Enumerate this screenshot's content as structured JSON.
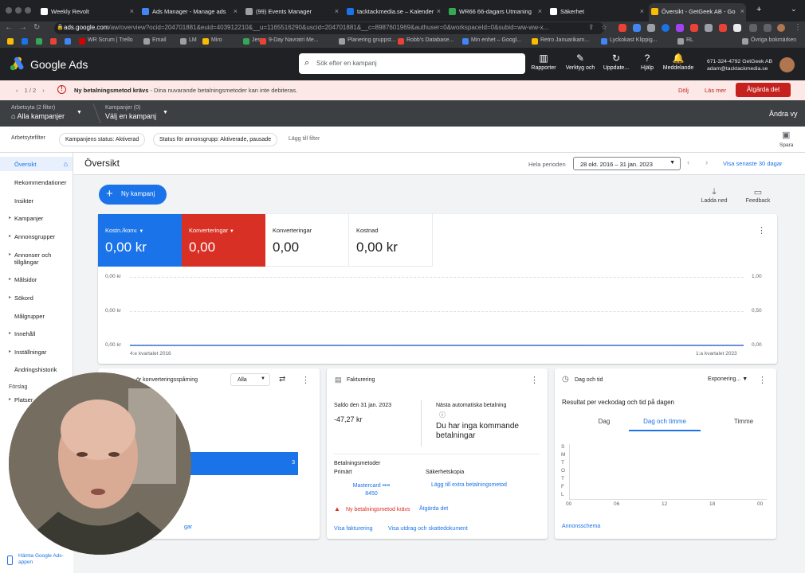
{
  "browser": {
    "tabs": [
      {
        "title": "Weekly Revolt",
        "color": "#ffffff",
        "active": false
      },
      {
        "title": "Ads Manager - Manage ads",
        "color": "#4285f4",
        "active": false
      },
      {
        "title": "(99) Events Manager",
        "color": "#9aa0a6",
        "active": false
      },
      {
        "title": "tacktackmedia.se – Kalender",
        "color": "#1a73e8",
        "active": false
      },
      {
        "title": "WR66 66-dagars Utmaning",
        "color": "#34a853",
        "active": false
      },
      {
        "title": "Säkerhet",
        "color": "#ffffff",
        "active": false
      },
      {
        "title": "Översikt - GetGeek AB - Go",
        "color": "#fbbc04",
        "active": true
      }
    ],
    "url_host": "ads.google.com",
    "url_rest": "/aw/overview?ocid=204701881&euid=403912210&__u=1165516290&uscid=204701881&__c=8987601969&authuser=0&workspaceId=0&subid=ww-ww-x...",
    "bookmarks": [
      {
        "label": "",
        "color": "#fbbc04"
      },
      {
        "label": "",
        "color": "#1a73e8"
      },
      {
        "label": "",
        "color": "#34a853"
      },
      {
        "label": "",
        "color": "#ea4335"
      },
      {
        "label": "",
        "color": "#4285f4"
      },
      {
        "label": "WR Scrum | Trello",
        "color": "#d50000"
      },
      {
        "label": "Email",
        "color": "#9aa0a6"
      },
      {
        "label": "LM",
        "color": "#9aa0a6"
      },
      {
        "label": "Miro",
        "color": "#fbbc04"
      },
      {
        "label": "Jes",
        "color": "#34a853"
      },
      {
        "label": "9-Day Navratri Me...",
        "color": "#ea4335"
      },
      {
        "label": "Planering gruppst...",
        "color": "#9aa0a6"
      },
      {
        "label": "Robb's Database...",
        "color": "#ea4335"
      },
      {
        "label": "Min enhet – Googl...",
        "color": "#4285f4"
      },
      {
        "label": "Retro Januarikam...",
        "color": "#fbbc04"
      },
      {
        "label": "Lyckokast Klippig...",
        "color": "#4285f4"
      },
      {
        "label": "RL",
        "color": "#9aa0a6"
      },
      {
        "label": "Övriga bokmärken",
        "color": "#9aa0a6"
      }
    ]
  },
  "header": {
    "brand": "Google Ads",
    "search_placeholder": "Sök efter en kampanj",
    "buttons": [
      {
        "label": "Rapporter",
        "icon": "bar-chart-icon",
        "glyph": "▥"
      },
      {
        "label": "Verktyg och",
        "icon": "wrench-icon",
        "glyph": "✎"
      },
      {
        "label": "Uppdate...",
        "icon": "refresh-icon",
        "glyph": "↻"
      },
      {
        "label": "Hjälp",
        "icon": "help-icon",
        "glyph": "?"
      },
      {
        "label": "Meddelande",
        "icon": "bell-icon",
        "glyph": "🔔"
      }
    ],
    "account_line1": "671-324-4792 GetGeek AB",
    "account_line2": "adam@tacktackmedia.se"
  },
  "banner": {
    "pagination": "1 / 2",
    "title": "Ny betalningsmetod krävs",
    "text": " - Dina nuvarande betalningsmetoder kan inte debiteras.",
    "dismiss": "Dölj",
    "learn_more": "Läs mer",
    "fix": "Åtgärda det"
  },
  "workspace": {
    "scope_label": "Arbetsyta (2 filter)",
    "scope_value": "Alla kampanjer",
    "campaign_label": "Kampanjer (0)",
    "campaign_value": "Välj en kampanj",
    "change_view": "Ändra vy"
  },
  "filters": {
    "label": "Arbetsytefilter",
    "chips": [
      "Kampanjens status: Aktiverad",
      "Status för annonsgrupp: Aktiverade, pausade"
    ],
    "add": "Lägg till filter",
    "save": "Spara"
  },
  "sidebar": {
    "items": [
      {
        "label": "Översikt",
        "arrow": false
      },
      {
        "label": "Rekommendationer",
        "arrow": false
      },
      {
        "label": "Insikter",
        "arrow": false
      },
      {
        "label": "Kampanjer",
        "arrow": true
      },
      {
        "label": "Annonsgrupper",
        "arrow": true
      },
      {
        "label": "Annonser och tillgångar",
        "arrow": true
      },
      {
        "label": "Målsidor",
        "arrow": true
      },
      {
        "label": "Sökord",
        "arrow": true
      },
      {
        "label": "Målgrupper",
        "arrow": false
      },
      {
        "label": "Innehåll",
        "arrow": true
      },
      {
        "label": "Inställningar",
        "arrow": true
      },
      {
        "label": "Ändringshistorik",
        "arrow": false
      }
    ],
    "section": "Förslag",
    "section_items": [
      "Platser"
    ],
    "get_app": "Hämta Google Ads-appen"
  },
  "overview": {
    "title": "Översikt",
    "period_label": "Hela perioden",
    "date_range": "28 okt. 2016 – 31 jan. 2023",
    "last30": "Visa senaste 30 dagar",
    "new_campaign": "Ny kampanj",
    "download": "Ladda ned",
    "feedback": "Feedback"
  },
  "kpis": [
    {
      "label": "Kostn./konv.",
      "value": "0,00 kr",
      "dropdown": true
    },
    {
      "label": "Konverteringar",
      "value": "0,00",
      "dropdown": true
    },
    {
      "label": "Konverteringar",
      "value": "0,00",
      "dropdown": false
    },
    {
      "label": "Kostnad",
      "value": "0,00 kr",
      "dropdown": false
    }
  ],
  "chart_data": {
    "type": "line",
    "x": [
      "4:e kvartalet 2016",
      "1:a kvartalet 2023"
    ],
    "series": [
      {
        "values": [
          0,
          0
        ],
        "color": "#d93025"
      },
      {
        "values": [
          0,
          0
        ],
        "color": "#1a73e8"
      }
    ],
    "left_axis_ticks": [
      "0,00 kr",
      "0,00 kr",
      "0,00 kr"
    ],
    "right_axis_ticks": [
      "1,00",
      "0,50",
      "0,00"
    ],
    "ylim": [
      0,
      1
    ]
  },
  "conversion_card": {
    "title_fragment": "ör konverteringsspårning",
    "select": "Alla",
    "bar_value": "3",
    "bar_fraction": 1,
    "footer_fragment": "gar"
  },
  "billing_card": {
    "title": "Fakturering",
    "balance_label": "Saldo den 31 jan. 2023",
    "balance": "-47,27 kr",
    "next_label": "Nästa automatiska betalning",
    "next_value": "Du har inga kommande betalningar",
    "methods_label": "Betalningsmetoder",
    "primary_label": "Primärt",
    "primary_card": "Mastercard •••• 8450",
    "backup_label": "Säkerhetskopia",
    "add_backup": "Lägg till extra betalningsmetod",
    "error": "Ny betalningsmetod krävs",
    "fix": "Åtgärda det",
    "view_billing": "Visa fakturering",
    "view_docs": "Visa utdrag och skattedokument"
  },
  "daytime_card": {
    "title": "Dag och tid",
    "metric": "Exponering...",
    "subtitle": "Resultat per veckodag och tid på dagen",
    "tabs": [
      "Dag",
      "Dag och timme",
      "Timme"
    ],
    "days": [
      "S",
      "M",
      "T",
      "O",
      "T",
      "F",
      "L"
    ],
    "hours": [
      "00",
      "06",
      "12",
      "18",
      "00"
    ],
    "footer": "Annonsschema"
  }
}
